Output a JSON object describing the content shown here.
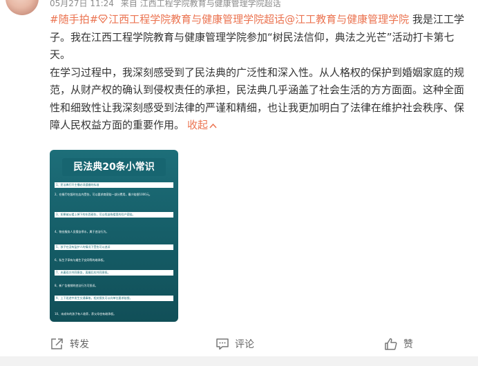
{
  "meta": {
    "timestamp": "05月27日 11:24",
    "source": "来自 江西工程学院教育与健康管理学院超话"
  },
  "post": {
    "hashtag": "#随手拍#",
    "supertopic_link": "江西工程学院教育与健康管理学院超话",
    "mention": "@江工教育与健康管理学院",
    "para1_rest": " 我是江工学子。我在江西工程学院教育与健康管理学院参加“树民法信仰，典法之光芒”活动打卡第七天。",
    "para2": "在学习过程中，我深刻感受到了民法典的广泛性和深入性。从人格权的保护到婚姻家庭的规范，从财产权的确认到侵权责任的承担，民法典几乎涵盖了社会生活的方方面面。这种全面性和细致性让我深刻感受到法律的严谨和精细，也让我更加明白了法律在维护社会秩序、保障人民权益方面的重要作用。",
    "collapse_label": "收起"
  },
  "image": {
    "title": "民法典20条小常识",
    "rules": [
      "1、民法典打开主播必须遵循的标准",
      "2、在餐厅吃饭时在店内受伤，可以要求商家赔一部分费用，最少赔偿1000元。",
      "3、如果被从楼上掉下的东西砸伤，可以找该栋楼里的住户索赔。",
      "4、物业服务人员擅自停水，属于违法行为。",
      "5、孩子在没有监护人的情况下受伤可以追诉",
      "6、私生子享有与婚生子女同等的继承权。",
      "7、夫妻双方共同债务，离婚后应共同承担。",
      "8、新广告推销的违法行为可投诉。",
      "9、上下班途中发生交通事故，相关损失可以向单位要求赔偿。",
      "10、未成年的孩子有人收养，养父母也有继承权。"
    ]
  },
  "toolbar": {
    "repost": "转发",
    "comment": "评论",
    "like": "赞"
  },
  "colors": {
    "accent": "#eb7350",
    "image_bg": "#1d6e79"
  }
}
